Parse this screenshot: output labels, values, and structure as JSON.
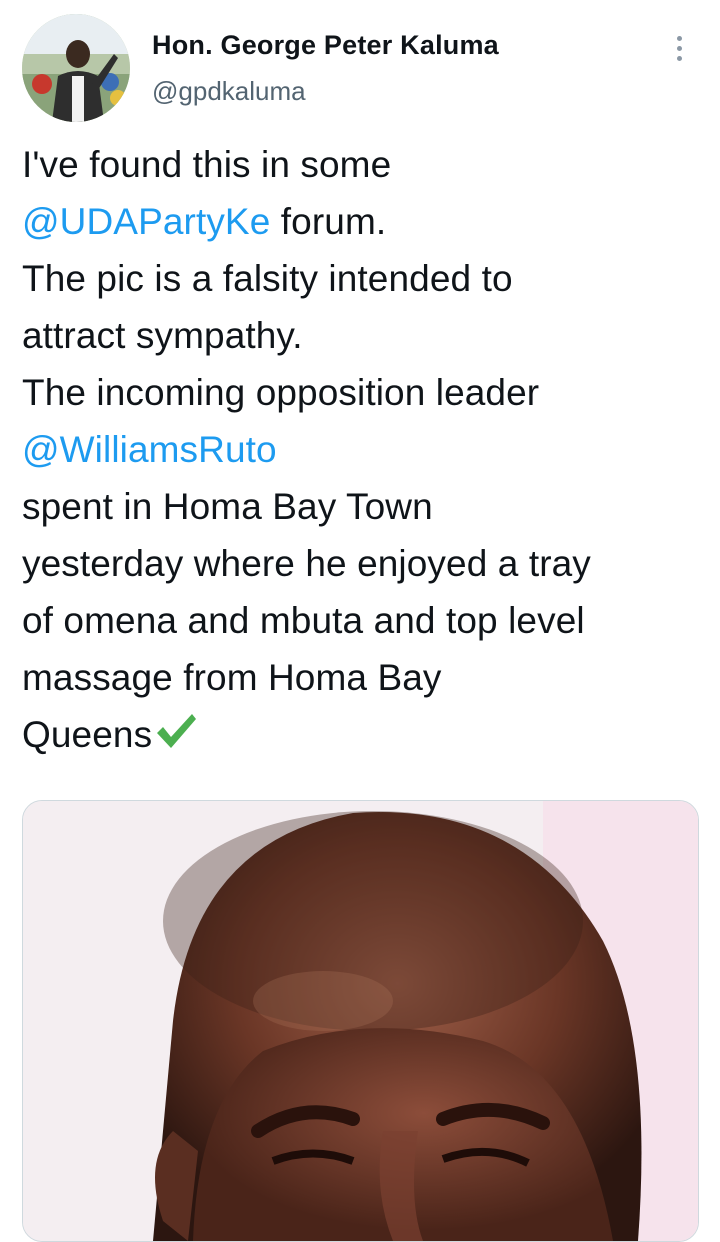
{
  "author": {
    "name": "Hon. George Peter Kaluma",
    "handle": "@gpdkaluma",
    "avatar_icon": "profile-photo"
  },
  "menu": {
    "icon": "more-vertical-icon"
  },
  "tweet": {
    "lines": [
      {
        "text": "I've found this in some"
      },
      {
        "mention": "@UDAPartyKe",
        "text": " forum."
      },
      {
        "text": "The pic is a falsity intended to"
      },
      {
        "text": "attract sympathy."
      },
      {
        "text": "The incoming opposition leader"
      },
      {
        "mention": "@WilliamsRuto"
      },
      {
        "text": "spent in Homa Bay Town"
      },
      {
        "text": "yesterday where he enjoyed a tray"
      },
      {
        "text": "of omena and mbuta and top level"
      },
      {
        "text": "massage from Homa Bay"
      },
      {
        "text": "Queens"
      }
    ],
    "emoji": "check-mark-icon"
  },
  "colors": {
    "mention": "#1d9bf0",
    "text": "#0f1419",
    "secondary": "#536471",
    "check": "#4caf50"
  },
  "media": {
    "description_icon": "attached-photo"
  }
}
